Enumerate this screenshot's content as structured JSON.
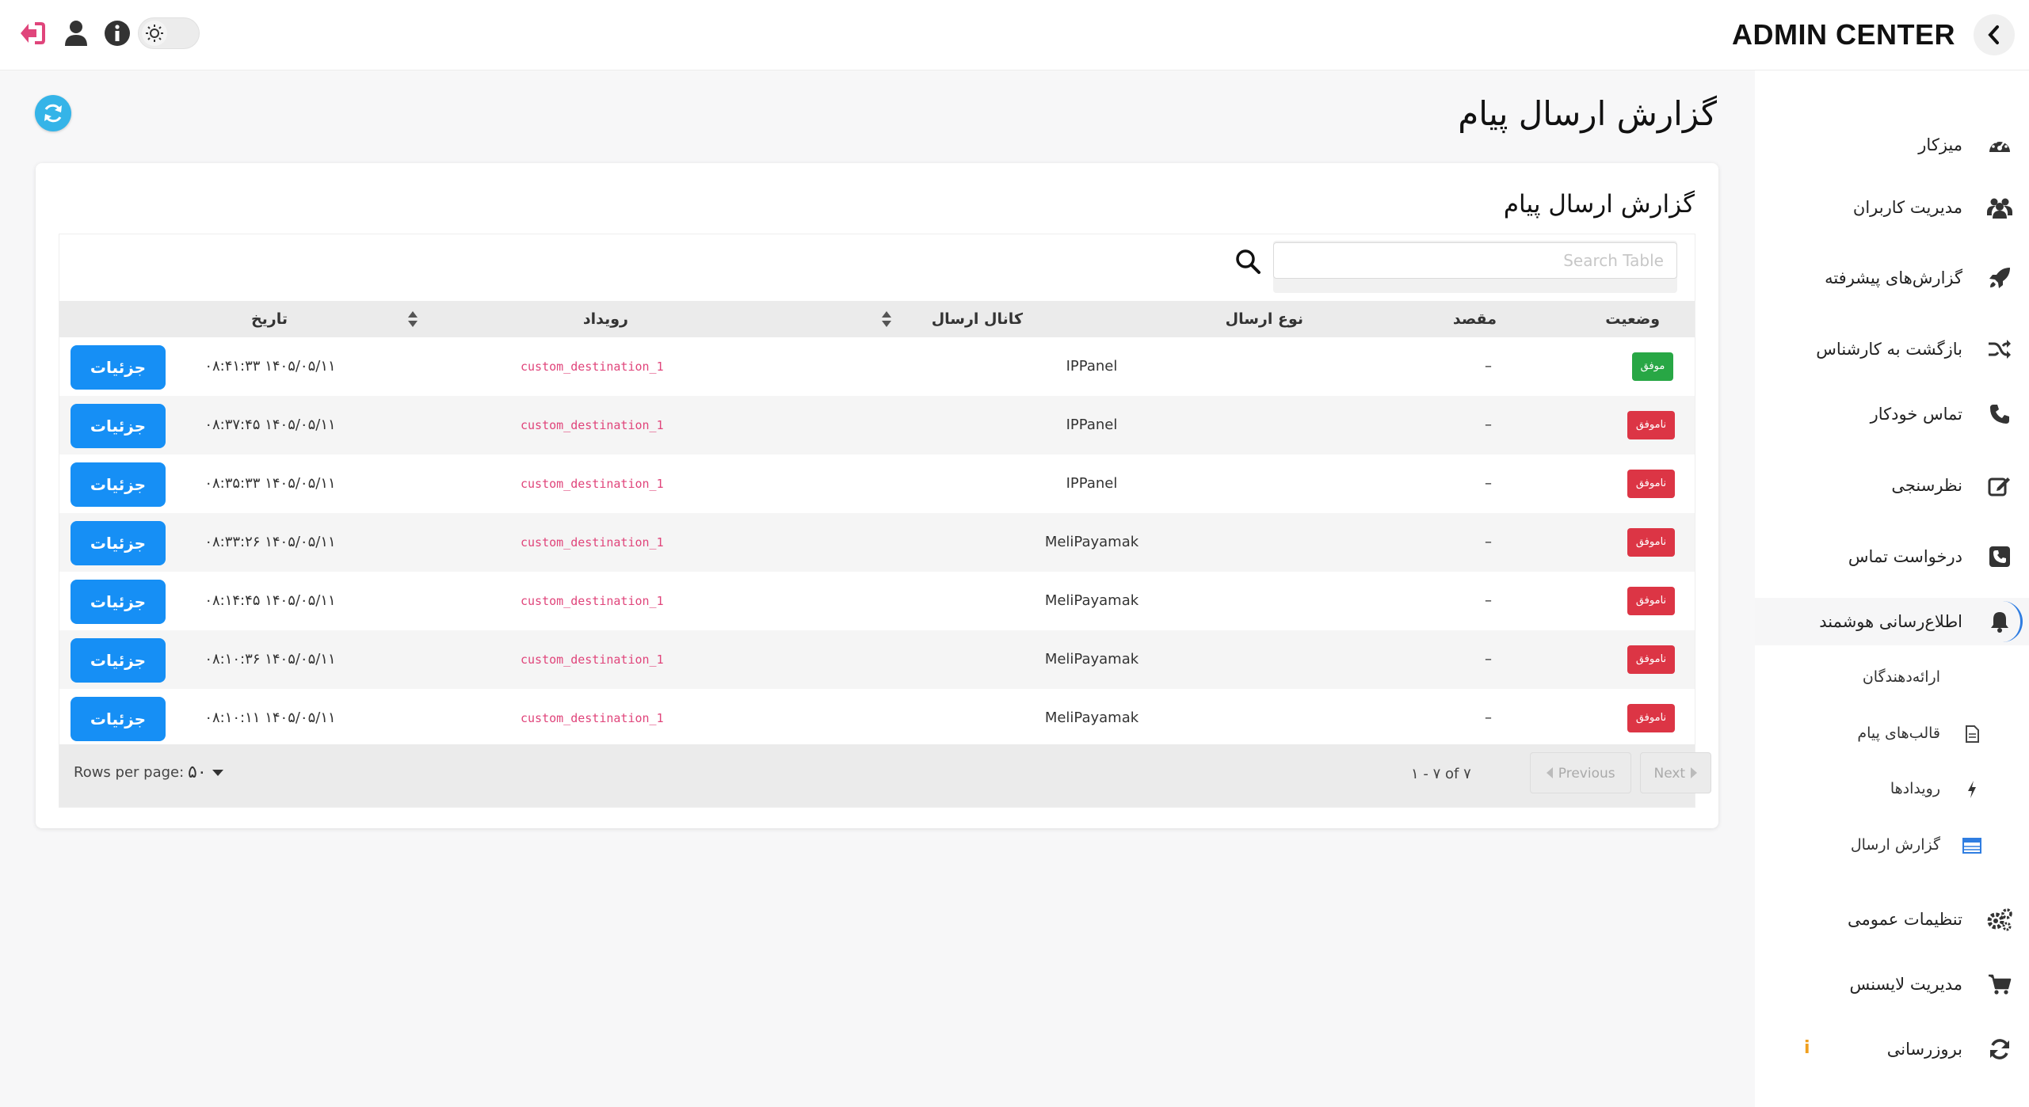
{
  "header": {
    "brand": "ADMIN CENTER"
  },
  "sidebar": {
    "items": [
      {
        "label": "میزکار",
        "icon": "speedometer-icon"
      },
      {
        "label": "مدیریت کاربران",
        "icon": "users-icon"
      },
      {
        "label": "گزارش‌های پیشرفته",
        "icon": "rocket-icon"
      },
      {
        "label": "بازگشت به کارشناس",
        "icon": "shuffle-icon"
      },
      {
        "label": "تماس خودکار",
        "icon": "phone-icon"
      },
      {
        "label": "نظرسنجی",
        "icon": "edit-icon"
      },
      {
        "label": "درخواست تماس",
        "icon": "phone-square-icon"
      },
      {
        "label": "اطلاع‌رسانی هوشمند",
        "icon": "bell-icon"
      },
      {
        "label": "تنظیمات عمومی",
        "icon": "gears-icon"
      },
      {
        "label": "مدیریت لایسنس",
        "icon": "cart-icon"
      },
      {
        "label": "بروزرسانی",
        "icon": "sync-icon"
      }
    ],
    "sub_items": [
      {
        "label": "ارائه‌دهندگان"
      },
      {
        "label": "قالب‌های پیام",
        "icon": "file-icon"
      },
      {
        "label": "رویدادها",
        "icon": "bolt-icon"
      },
      {
        "label": "گزارش ارسال",
        "icon": "table-icon"
      }
    ],
    "update_badge": "i"
  },
  "page": {
    "title": "گزارش ارسال پیام"
  },
  "card": {
    "title": "گزارش ارسال پیام"
  },
  "search": {
    "placeholder": "Search Table"
  },
  "table": {
    "columns": {
      "status": "وضعیت",
      "destination": "مقصد",
      "send_type": "نوع ارسال",
      "channel": "کانال ارسال",
      "event": "رویداد",
      "date": "تاریخ"
    },
    "rows": [
      {
        "status": "موفق",
        "destination": "–",
        "send_type": "",
        "channel": "IPPanel",
        "event": "custom_destination_1",
        "date": "۱۴۰۵/۰۵/۱۱ ۰۸:۴۱:۳۳",
        "action": "جزئیات"
      },
      {
        "status": "ناموفق",
        "destination": "–",
        "send_type": "",
        "channel": "IPPanel",
        "event": "custom_destination_1",
        "date": "۱۴۰۵/۰۵/۱۱ ۰۸:۳۷:۴۵",
        "action": "جزئیات"
      },
      {
        "status": "ناموفق",
        "destination": "–",
        "send_type": "",
        "channel": "IPPanel",
        "event": "custom_destination_1",
        "date": "۱۴۰۵/۰۵/۱۱ ۰۸:۳۵:۳۳",
        "action": "جزئیات"
      },
      {
        "status": "ناموفق",
        "destination": "–",
        "send_type": "",
        "channel": "MeliPayamak",
        "event": "custom_destination_1",
        "date": "۱۴۰۵/۰۵/۱۱ ۰۸:۳۳:۲۶",
        "action": "جزئیات"
      },
      {
        "status": "ناموفق",
        "destination": "–",
        "send_type": "",
        "channel": "MeliPayamak",
        "event": "custom_destination_1",
        "date": "۱۴۰۵/۰۵/۱۱ ۰۸:۱۴:۴۵",
        "action": "جزئیات"
      },
      {
        "status": "ناموفق",
        "destination": "–",
        "send_type": "",
        "channel": "MeliPayamak",
        "event": "custom_destination_1",
        "date": "۱۴۰۵/۰۵/۱۱ ۰۸:۱۰:۳۶",
        "action": "جزئیات"
      },
      {
        "status": "ناموفق",
        "destination": "–",
        "send_type": "",
        "channel": "MeliPayamak",
        "event": "custom_destination_1",
        "date": "۱۴۰۵/۰۵/۱۱ ۰۸:۱۰:۱۱",
        "action": "جزئیات"
      }
    ]
  },
  "pagination": {
    "rows_per_page_label": "Rows per page:",
    "rows_per_page_value": "۵۰",
    "range": "۱ - ۷ of ۷",
    "previous": "Previous",
    "next": "Next"
  },
  "colors": {
    "success": "#28a745",
    "failure": "#dc3545",
    "primary": "#168ff5",
    "accent": "#e0457b"
  }
}
